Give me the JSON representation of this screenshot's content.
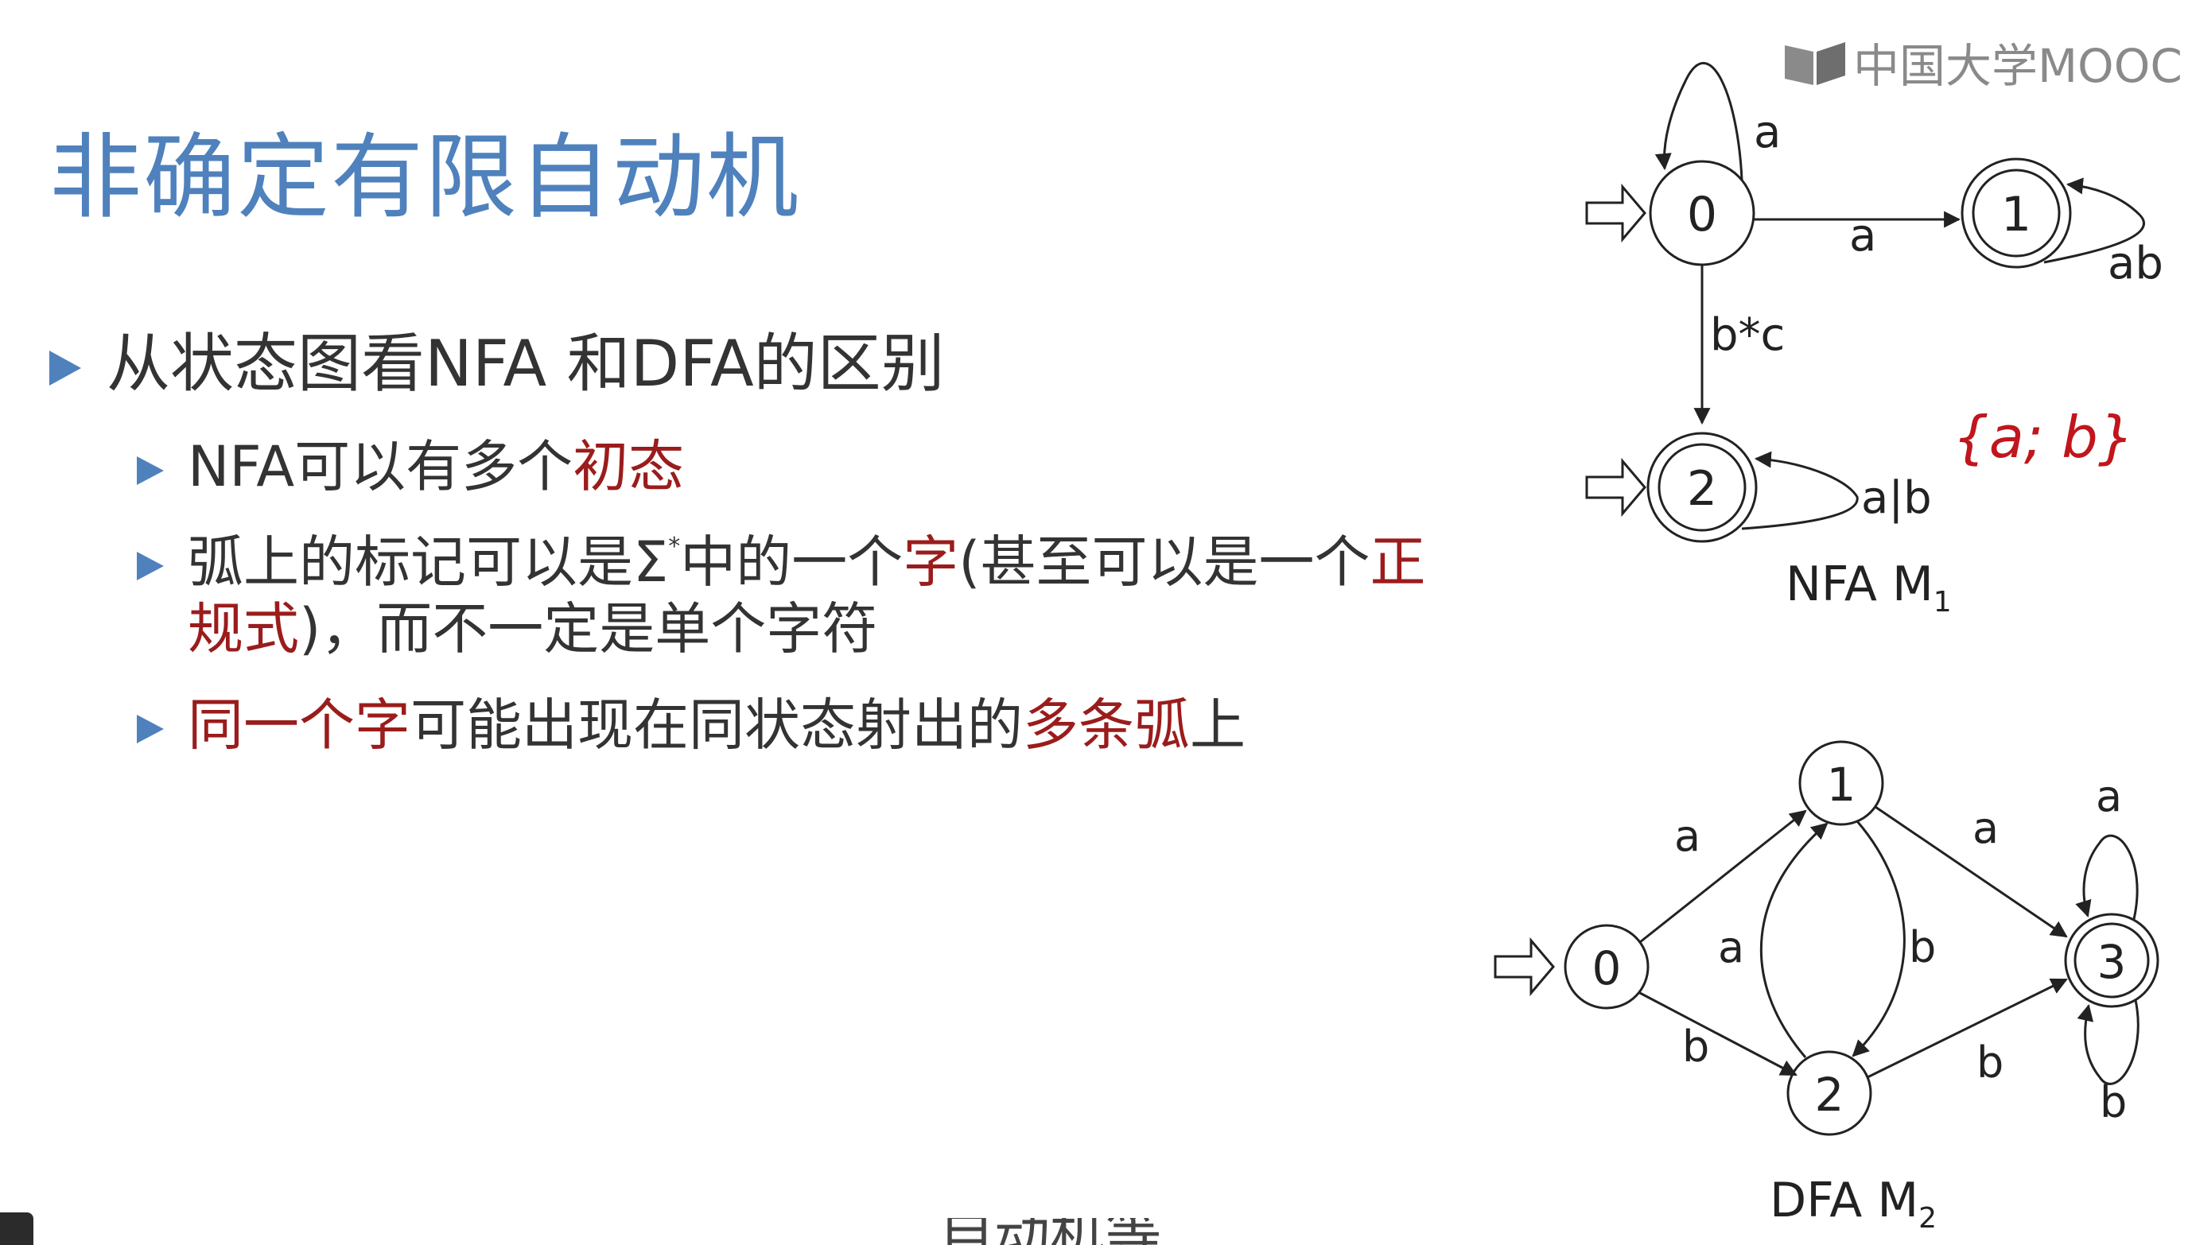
{
  "slide": {
    "title": "非确定有限自动机",
    "bullet1": "从状态图看NFA 和DFA的区别",
    "sub1": {
      "a": "NFA可以有多个",
      "b": "初态"
    },
    "sub2": {
      "a": "弧上的标记可以是Σ",
      "sup": "*",
      "b": "中的一个",
      "c": "字",
      "d": "(甚至可以是一个",
      "e": "正",
      "f": "规式",
      "g": ")，而不一定是单个字符"
    },
    "sub3": {
      "a": "同一个字",
      "b": "可能出现在同状态射出的",
      "c": "多条弧",
      "d": "上"
    },
    "handwritten": "{a; b}",
    "bottom_cut_text": "自动机等"
  },
  "logo": {
    "text": "中国大学MOOC",
    "icon": "mooc-book-icon"
  },
  "nfa": {
    "caption": "NFA  M",
    "caption_sub": "1",
    "states": [
      "0",
      "1",
      "2"
    ],
    "labels": {
      "self0": "a",
      "e01": "a",
      "self1": "ab",
      "e02": "b*c",
      "self2": "a|b"
    }
  },
  "dfa": {
    "caption": "DFA M",
    "caption_sub": "2",
    "states": [
      "0",
      "1",
      "2",
      "3"
    ],
    "labels": {
      "e01": "a",
      "e02": "b",
      "e21": "a",
      "e12": "b",
      "e13": "a",
      "e23": "b",
      "self3a": "a",
      "self3b": "b"
    }
  },
  "colors": {
    "title": "#4f81bd",
    "accent_red": "#9b1c1c",
    "bullet": "#4f81bd",
    "text": "#333333"
  }
}
